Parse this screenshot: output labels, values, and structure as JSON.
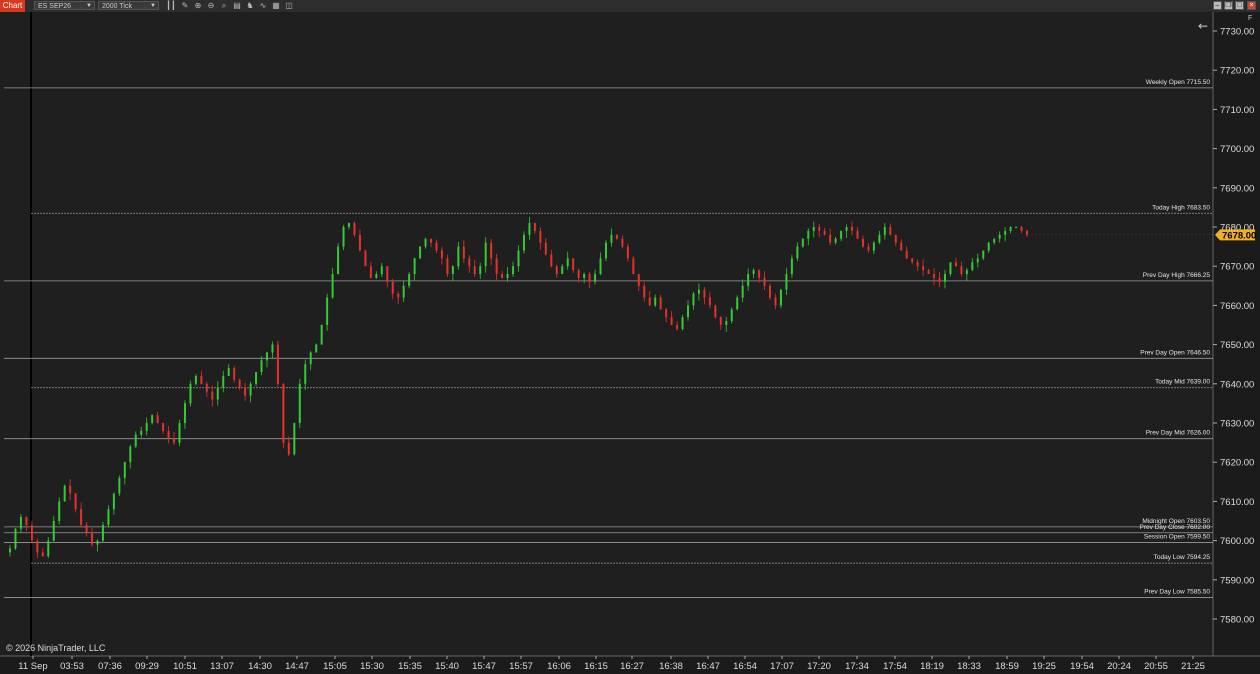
{
  "toolbar": {
    "tab": "Chart",
    "instrument": "ES SEP26",
    "period": "2000 Tick",
    "icons": [
      "bar-type-icon",
      "draw-line-icon",
      "zoom-in-icon",
      "zoom-out-icon",
      "search-icon",
      "properties-icon",
      "strategies-icon",
      "indicators-icon",
      "templates-icon",
      "snap-icon"
    ]
  },
  "window": {
    "minimize": "–",
    "maximize": "□",
    "restore": "❐",
    "close": "×",
    "f_label": "F"
  },
  "copyright": "© 2026 NinjaTrader, LLC",
  "colors": {
    "bg": "#1f1f1f",
    "up": "#33cc33",
    "down": "#e8312a",
    "grid": "#3a3a3a",
    "text": "#dddddd",
    "price_badge": "#f0b020"
  },
  "chart_data": {
    "type": "candlestick",
    "instrument": "ES SEP26",
    "y_ticks": [
      7730,
      7720,
      7710,
      7700,
      7690,
      7680,
      7670,
      7660,
      7650,
      7640,
      7630,
      7620,
      7610,
      7600,
      7590,
      7580
    ],
    "ylim": [
      7575,
      7735
    ],
    "x_labels": [
      "11 Sep",
      "03:53",
      "07:36",
      "09:29",
      "10:51",
      "13:07",
      "14:30",
      "14:47",
      "15:05",
      "15:30",
      "15:35",
      "15:40",
      "15:47",
      "15:57",
      "16:06",
      "16:15",
      "16:27",
      "16:38",
      "16:47",
      "16:54",
      "17:07",
      "17:20",
      "17:34",
      "17:54",
      "18:19",
      "18:33",
      "18:59",
      "19:25",
      "19:54",
      "20:24",
      "20:55",
      "21:25"
    ],
    "last_price": "7678.00",
    "levels": [
      {
        "label": "Weekly Open",
        "value": "7715.50",
        "price": 7715.5
      },
      {
        "label": "Today High",
        "value": "7683.50",
        "price": 7683.5
      },
      {
        "label": "Prev Day High",
        "value": "7666.25",
        "price": 7666.25
      },
      {
        "label": "Prev Day Open",
        "value": "7646.50",
        "price": 7646.5
      },
      {
        "label": "Today Mid",
        "value": "7639.00",
        "price": 7639.0
      },
      {
        "label": "Prev Day Mid",
        "value": "7626.00",
        "price": 7626.0
      },
      {
        "label": "Midnight Open",
        "value": "7603.50",
        "price": 7603.5
      },
      {
        "label": "Prev Day Close",
        "value": "7602.00",
        "price": 7602.0
      },
      {
        "label": "Session Open",
        "value": "7599.50",
        "price": 7599.5
      },
      {
        "label": "Today Low",
        "value": "7594.25",
        "price": 7594.25
      },
      {
        "label": "Prev Day Low",
        "value": "7585.50",
        "price": 7585.5
      }
    ],
    "path": [
      7598,
      7603,
      7606,
      7604,
      7600,
      7597,
      7596,
      7600,
      7605,
      7610,
      7614,
      7612,
      7608,
      7604,
      7602,
      7599,
      7600,
      7604,
      7608,
      7612,
      7616,
      7620,
      7624,
      7627,
      7628,
      7630,
      7632,
      7630,
      7628,
      7626,
      7625,
      7630,
      7635,
      7640,
      7642,
      7640,
      7638,
      7636,
      7639,
      7642,
      7644,
      7641,
      7639,
      7637,
      7640,
      7643,
      7646,
      7648,
      7650,
      7640,
      7625,
      7622,
      7630,
      7640,
      7645,
      7648,
      7650,
      7655,
      7662,
      7668,
      7675,
      7680,
      7681,
      7678,
      7674,
      7670,
      7667,
      7668,
      7670,
      7666,
      7663,
      7662,
      7665,
      7668,
      7672,
      7675,
      7677,
      7676,
      7674,
      7672,
      7668,
      7670,
      7675,
      7672,
      7670,
      7668,
      7670,
      7676,
      7672,
      7668,
      7667,
      7668,
      7670,
      7674,
      7678,
      7681,
      7679,
      7676,
      7673,
      7670,
      7668,
      7670,
      7672,
      7669,
      7667,
      7668,
      7666,
      7668,
      7672,
      7676,
      7678,
      7677,
      7675,
      7672,
      7668,
      7665,
      7662,
      7660,
      7662,
      7659,
      7657,
      7655,
      7654,
      7657,
      7660,
      7663,
      7664,
      7662,
      7660,
      7657,
      7655,
      7656,
      7659,
      7662,
      7665,
      7668,
      7669,
      7667,
      7665,
      7662,
      7660,
      7664,
      7668,
      7672,
      7675,
      7677,
      7679,
      7680,
      7679,
      7678,
      7676,
      7677,
      7679,
      7680,
      7679,
      7677,
      7675,
      7674,
      7676,
      7678,
      7680,
      7678,
      7676,
      7674,
      7672,
      7671,
      7670,
      7669,
      7668,
      7667,
      7666,
      7668,
      7671,
      7670,
      7668,
      7669,
      7671,
      7672,
      7674,
      7676,
      7677,
      7678,
      7679,
      7680,
      7680,
      7679,
      7678
    ]
  }
}
